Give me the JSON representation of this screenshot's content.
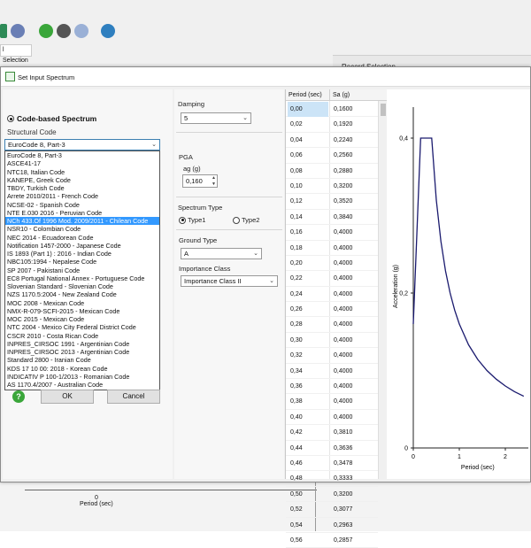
{
  "app": {
    "tab_label": "l Selection",
    "right_header": "Record Selection",
    "bottom_chart": {
      "tick": "0",
      "xlabel": "Period (sec)"
    }
  },
  "dialog": {
    "title": "Set Input Spectrum",
    "code_based_label": "Code-based Spectrum",
    "structural_code_label": "Structural Code",
    "selected_code": "EuroCode 8, Part-3",
    "hovered_index": 9,
    "code_options": [
      "EuroCode 8, Part-3",
      "ASCE41-17",
      "NTC18, Italian Code",
      "KANEPE, Greek Code",
      "TBDY, Turkish Code",
      "Arrete 2010/2011 - French Code",
      "NCSE-02 - Spanish Code",
      "NTE E.030 2016 - Peruvian Code",
      "NCh 433.Of 1996 Mod. 2009/2011 - Chilean Code",
      "NSR10 - Colombian Code",
      "NEC 2014 - Ecuadorean Code",
      "Notification 1457-2000 - Japanese Code",
      "IS 1893 (Part 1) : 2016 - Indian Code",
      "NBC105:1994 - Nepalese Code",
      "SP 2007 - Pakistani Code",
      "EC8 Portugal National Annex - Portuguese Code",
      "Slovenian Standard - Slovenian Code",
      "NZS 1170.5:2004 - New Zealand Code",
      "MOC 2008 - Mexican Code",
      "NMX-R-079-SCFI-2015 - Mexican Code",
      "MOC 2015 - Mexican Code",
      "NTC 2004 - Mexico City Federal District Code",
      "CSCR 2010 - Costa Rican Code",
      "INPRES_CIRSOC 1991 - Argentinian Code",
      "INPRES_CIRSOC 2013 - Argentinian Code",
      "Standard 2800 - Iranian Code",
      "KDS 17 10 00: 2018 - Korean Code",
      "INDICATIV P 100-1/2013 - Romanian Code",
      "AS 1170.4/2007 - Australian Code"
    ],
    "ok_label": "OK",
    "cancel_label": "Cancel",
    "help_glyph": "?",
    "damping_label": "Damping",
    "damping_value": "5",
    "pga_label": "PGA",
    "ag_label": "ag (g)",
    "ag_value": "0,160",
    "spectrum_type_label": "Spectrum Type",
    "type1_label": "Type1",
    "type2_label": "Type2",
    "ground_type_label": "Ground Type",
    "ground_type_value": "A",
    "importance_label": "Importance Class",
    "importance_value": "Importance Class II",
    "table": {
      "col1": "Period (sec)",
      "col2": "Sa  (g)",
      "rows": [
        [
          "0,00",
          "0,1600"
        ],
        [
          "0,02",
          "0,1920"
        ],
        [
          "0,04",
          "0,2240"
        ],
        [
          "0,06",
          "0,2560"
        ],
        [
          "0,08",
          "0,2880"
        ],
        [
          "0,10",
          "0,3200"
        ],
        [
          "0,12",
          "0,3520"
        ],
        [
          "0,14",
          "0,3840"
        ],
        [
          "0,16",
          "0,4000"
        ],
        [
          "0,18",
          "0,4000"
        ],
        [
          "0,20",
          "0,4000"
        ],
        [
          "0,22",
          "0,4000"
        ],
        [
          "0,24",
          "0,4000"
        ],
        [
          "0,26",
          "0,4000"
        ],
        [
          "0,28",
          "0,4000"
        ],
        [
          "0,30",
          "0,4000"
        ],
        [
          "0,32",
          "0,4000"
        ],
        [
          "0,34",
          "0,4000"
        ],
        [
          "0,36",
          "0,4000"
        ],
        [
          "0,38",
          "0,4000"
        ],
        [
          "0,40",
          "0,4000"
        ],
        [
          "0,42",
          "0,3810"
        ],
        [
          "0,44",
          "0,3636"
        ],
        [
          "0,46",
          "0,3478"
        ],
        [
          "0,48",
          "0,3333"
        ],
        [
          "0,50",
          "0,3200"
        ],
        [
          "0,52",
          "0,3077"
        ],
        [
          "0,54",
          "0,2963"
        ],
        [
          "0,56",
          "0,2857"
        ]
      ]
    }
  },
  "chart_data": {
    "type": "line",
    "xlabel": "Period (sec)",
    "ylabel": "Acceleration (g)",
    "x_ticks": [
      "0",
      "1",
      "2"
    ],
    "y_ticks": [
      "0",
      "0,2",
      "0,4"
    ],
    "xlim": [
      0,
      2.5
    ],
    "ylim": [
      0,
      0.44
    ],
    "series": [
      {
        "x": [
          0,
          0.16,
          0.2,
          0.4,
          0.5,
          0.6,
          0.7,
          0.8,
          0.9,
          1.0,
          1.2,
          1.4,
          1.6,
          1.8,
          2.0,
          2.2,
          2.4
        ],
        "y": [
          0.16,
          0.4,
          0.4,
          0.4,
          0.32,
          0.2667,
          0.2286,
          0.2,
          0.1778,
          0.16,
          0.1333,
          0.1143,
          0.1,
          0.0889,
          0.08,
          0.0727,
          0.0667
        ]
      }
    ]
  }
}
